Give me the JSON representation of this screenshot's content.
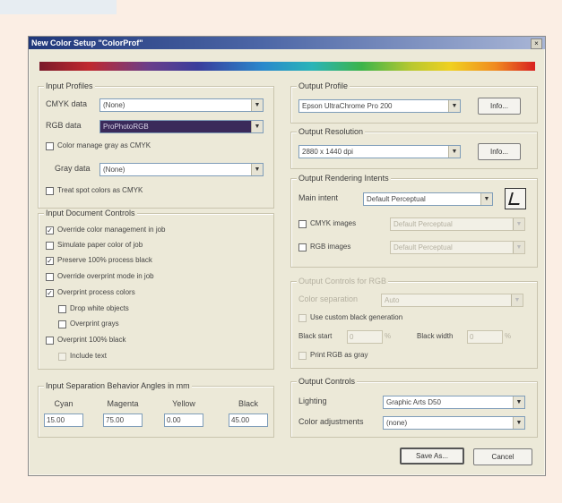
{
  "dialog": {
    "title": "New Color Setup \"ColorProf\"",
    "close_glyph": "×"
  },
  "input_profiles": {
    "title": "Input Profiles",
    "cmyk_label": "CMYK data",
    "cmyk_value": "(None)",
    "rgb_label": "RGB data",
    "rgb_value": "ProPhotoRGB",
    "color_manage_gray_label": "Color manage gray as CMYK",
    "gray_label": "Gray data",
    "gray_value": "(None)",
    "treat_spot_label": "Treat spot colors as CMYK"
  },
  "document_controls": {
    "title": "Input Document Controls",
    "items": [
      {
        "label": "Override color management in job",
        "checked": "✓"
      },
      {
        "label": "Simulate paper color of job",
        "checked": ""
      },
      {
        "label": "Preserve 100% process black",
        "checked": "✓"
      },
      {
        "label": "Override overprint mode in job",
        "checked": ""
      },
      {
        "label": "Overprint process colors",
        "checked": "✓"
      },
      {
        "label": "Drop white objects",
        "checked": ""
      },
      {
        "label": "Overprint grays",
        "checked": ""
      },
      {
        "label": "Overprint 100% black",
        "checked": ""
      },
      {
        "label": "Include text",
        "checked": ""
      }
    ]
  },
  "screen_angles": {
    "title": "Input Separation Behavior Angles in mm",
    "cols": [
      {
        "label": "Cyan",
        "value": "15.00"
      },
      {
        "label": "Magenta",
        "value": "75.00"
      },
      {
        "label": "Yellow",
        "value": "0.00"
      },
      {
        "label": "Black",
        "value": "45.00"
      }
    ]
  },
  "output_profile": {
    "title": "Output Profile",
    "value": "Epson UltraChrome Pro 200",
    "info_label": "Info..."
  },
  "output_resolution": {
    "title": "Output Resolution",
    "value": "2880 x 1440 dpi",
    "info_label": "Info..."
  },
  "rendering_intents": {
    "title": "Output Rendering Intents",
    "main_label": "Main intent",
    "main_value": "Default Perceptual",
    "cmyk_images_label": "CMYK images",
    "cmyk_images_value": "Default Perceptual",
    "rgb_images_label": "RGB images",
    "rgb_images_value": "Default Perceptual"
  },
  "controls_rgb": {
    "title": "Output Controls for RGB",
    "select_label": "Color separation",
    "select_value": "Auto",
    "option_label": "Use custom black generation",
    "field1_label": "Black start",
    "field1_value": "0",
    "field2_label": "Black width",
    "field2_value": "0",
    "pct": "%",
    "option2_label": "Print RGB as gray"
  },
  "output_controls": {
    "title": "Output Controls",
    "lighting_label": "Lighting",
    "lighting_value": "Graphic Arts D50",
    "color_adj_label": "Color adjustments",
    "color_adj_value": "(none)"
  },
  "buttons": {
    "ok": "Save As...",
    "cancel": "Cancel"
  },
  "colors": {
    "dialog_bg": "#ece9d8",
    "page_bg": "#fbeee4",
    "titlebar": "#20377a",
    "highlight": "#3a2a5a"
  },
  "icons": [
    "close-icon",
    "chevron-down-icon",
    "eyedropper-icon"
  ]
}
